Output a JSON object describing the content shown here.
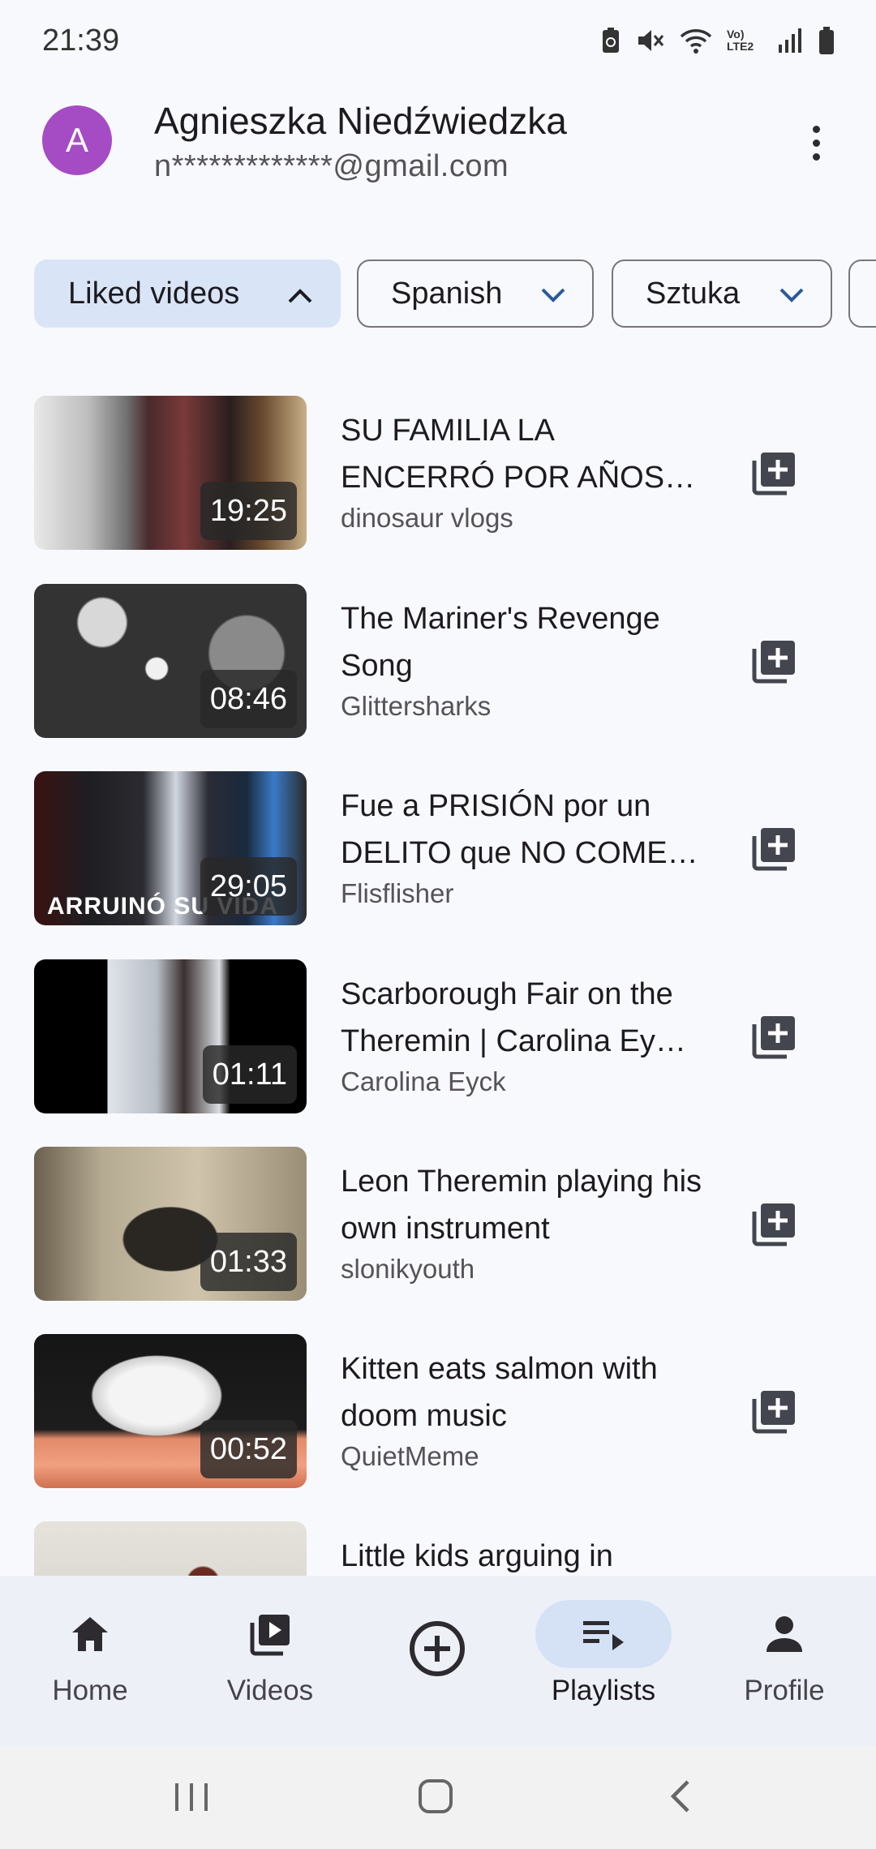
{
  "status": {
    "time": "21:39",
    "network": "Vo) LTE2"
  },
  "account": {
    "initial": "A",
    "name": "Agnieszka Niedźwiedzka",
    "email": "n*************@gmail.com",
    "avatar_color": "#a54cc5"
  },
  "chips": [
    {
      "label": "Liked videos",
      "active": true,
      "chevron": "chevron-up-icon"
    },
    {
      "label": "Spanish",
      "active": false,
      "chevron": "chevron-down-icon"
    },
    {
      "label": "Sztuka",
      "active": false,
      "chevron": "chevron-down-icon"
    }
  ],
  "videos": [
    {
      "title": "SU FAMILIA LA ENCERRÓ POR AÑOS -…",
      "channel": "dinosaur vlogs",
      "duration": "19:25"
    },
    {
      "title": "The Mariner's Revenge Song",
      "channel": "Glittersharks",
      "duration": "08:46"
    },
    {
      "title": "Fue a PRISIÓN por un DELITO que NO COME…",
      "channel": "Flisflisher",
      "duration": "29:05",
      "thumb_text": "ARRUINÓ SU VIDA"
    },
    {
      "title": "Scarborough Fair on the Theremin | Carolina Ey…",
      "channel": "Carolina Eyck",
      "duration": "01:11"
    },
    {
      "title": "Leon Theremin playing his own instrument",
      "channel": "slonikyouth",
      "duration": "01:33"
    },
    {
      "title": "Kitten eats salmon  with doom music",
      "channel": "QuietMeme",
      "duration": "00:52"
    },
    {
      "title": "Little kids arguing in",
      "channel": "",
      "duration": ""
    }
  ],
  "nav": {
    "home": "Home",
    "videos": "Videos",
    "playlists": "Playlists",
    "profile": "Profile"
  },
  "colors": {
    "accent_chip": "#d9e5f7",
    "nav_background": "#edf0f7",
    "nav_active_pill": "#d5e2f5"
  }
}
